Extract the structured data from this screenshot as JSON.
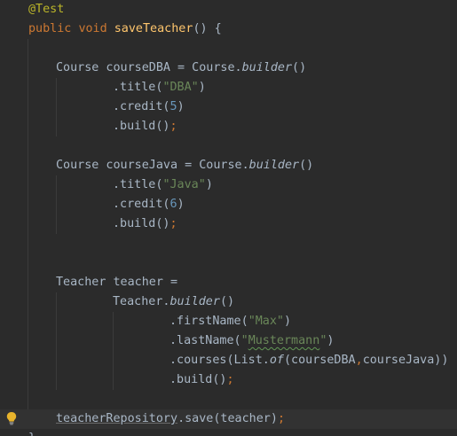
{
  "editor": {
    "lines": [
      {
        "segments": [
          {
            "t": "@Test",
            "c": "ann"
          }
        ]
      },
      {
        "segments": [
          {
            "t": "public",
            "c": "kw"
          },
          {
            "t": " "
          },
          {
            "t": "void",
            "c": "kw"
          },
          {
            "t": " "
          },
          {
            "t": "saveTeacher",
            "c": "fn"
          },
          {
            "t": "() {"
          }
        ]
      },
      {
        "segments": []
      },
      {
        "segments": [
          {
            "t": "Course courseDBA = Course."
          },
          {
            "t": "builder",
            "c": "it"
          },
          {
            "t": "()"
          }
        ]
      },
      {
        "segments": [
          {
            "t": ".title("
          },
          {
            "t": "\"DBA\"",
            "c": "str"
          },
          {
            "t": ")"
          }
        ]
      },
      {
        "segments": [
          {
            "t": ".credit("
          },
          {
            "t": "5",
            "c": "num"
          },
          {
            "t": ")"
          }
        ]
      },
      {
        "segments": [
          {
            "t": ".build()"
          },
          {
            "t": ";",
            "c": "punc"
          }
        ]
      },
      {
        "segments": []
      },
      {
        "segments": [
          {
            "t": "Course courseJava = Course."
          },
          {
            "t": "builder",
            "c": "it"
          },
          {
            "t": "()"
          }
        ]
      },
      {
        "segments": [
          {
            "t": ".title("
          },
          {
            "t": "\"Java\"",
            "c": "str"
          },
          {
            "t": ")"
          }
        ]
      },
      {
        "segments": [
          {
            "t": ".credit("
          },
          {
            "t": "6",
            "c": "num"
          },
          {
            "t": ")"
          }
        ]
      },
      {
        "segments": [
          {
            "t": ".build()"
          },
          {
            "t": ";",
            "c": "punc"
          }
        ]
      },
      {
        "segments": []
      },
      {
        "segments": []
      },
      {
        "segments": [
          {
            "t": "Teacher teacher ="
          }
        ]
      },
      {
        "segments": [
          {
            "t": "Teacher."
          },
          {
            "t": "builder",
            "c": "it"
          },
          {
            "t": "()"
          }
        ]
      },
      {
        "segments": [
          {
            "t": ".firstName("
          },
          {
            "t": "\"Max\"",
            "c": "str"
          },
          {
            "t": ")"
          }
        ]
      },
      {
        "segments": [
          {
            "t": ".lastName("
          },
          {
            "t": "\"",
            "c": "str"
          },
          {
            "t": "Mustermann",
            "c": "str typo"
          },
          {
            "t": "\"",
            "c": "str"
          },
          {
            "t": ")"
          }
        ]
      },
      {
        "segments": [
          {
            "t": ".courses(List."
          },
          {
            "t": "of",
            "c": "it"
          },
          {
            "t": "(courseDBA"
          },
          {
            "t": ",",
            "c": "punc"
          },
          {
            "t": "courseJava))"
          }
        ]
      },
      {
        "segments": [
          {
            "t": ".build()"
          },
          {
            "t": ";",
            "c": "punc"
          }
        ]
      },
      {
        "segments": []
      },
      {
        "segments": [
          {
            "t": "teacherRepository",
            "c": "unused"
          },
          {
            "t": ".save(teacher)"
          },
          {
            "t": ";",
            "c": "punc"
          }
        ]
      },
      {
        "segments": [
          {
            "t": "}"
          }
        ]
      }
    ]
  },
  "gutter": {
    "icon": "lightbulb-icon",
    "icon_color": "#e8b42c"
  },
  "colors": {
    "background": "#2b2b2b",
    "current_line": "#323232"
  }
}
